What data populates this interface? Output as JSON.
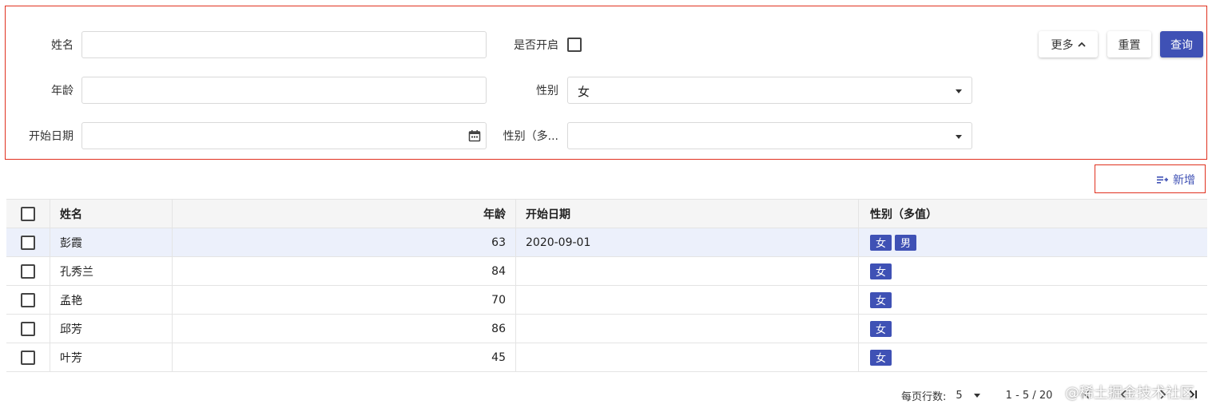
{
  "search": {
    "name_label": "姓名",
    "name_value": "",
    "enabled_label": "是否开启",
    "age_label": "年龄",
    "age_value": "",
    "gender_label": "性别",
    "gender_value": "女",
    "start_date_label": "开始日期",
    "start_date_value": "",
    "gender_multi_label": "性别（多...",
    "gender_multi_value": "",
    "more_button": "更多",
    "reset_button": "重置",
    "query_button": "查询"
  },
  "toolbar": {
    "add_label": "新增"
  },
  "table": {
    "columns": {
      "name": "姓名",
      "age": "年龄",
      "start_date": "开始日期",
      "gender_multi": "性别（多值）"
    },
    "rows": [
      {
        "name": "彭霞",
        "age": "63",
        "start_date": "2020-09-01",
        "genders": [
          "女",
          "男"
        ]
      },
      {
        "name": "孔秀兰",
        "age": "84",
        "start_date": "",
        "genders": [
          "女"
        ]
      },
      {
        "name": "孟艳",
        "age": "70",
        "start_date": "",
        "genders": [
          "女"
        ]
      },
      {
        "name": "邱芳",
        "age": "86",
        "start_date": "",
        "genders": [
          "女"
        ]
      },
      {
        "name": "叶芳",
        "age": "45",
        "start_date": "",
        "genders": [
          "女"
        ]
      }
    ]
  },
  "pagination": {
    "rows_per_page_label": "每页行数:",
    "rows_per_page_value": "5",
    "range_text": "1 - 5 / 20"
  },
  "watermark": "@稀土掘金技术社区",
  "colors": {
    "primary": "#3f51b5",
    "highlight_border": "#e0311f",
    "selected_row": "#ecf0fb"
  }
}
